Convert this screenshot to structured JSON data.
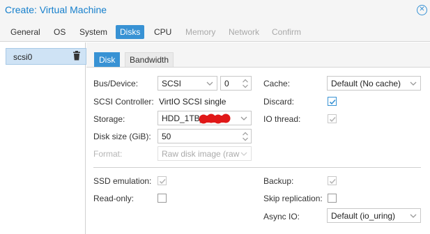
{
  "window": {
    "title": "Create: Virtual Machine"
  },
  "tabs": [
    {
      "label": "General",
      "state": "normal"
    },
    {
      "label": "OS",
      "state": "normal"
    },
    {
      "label": "System",
      "state": "normal"
    },
    {
      "label": "Disks",
      "state": "active"
    },
    {
      "label": "CPU",
      "state": "normal"
    },
    {
      "label": "Memory",
      "state": "disabled"
    },
    {
      "label": "Network",
      "state": "disabled"
    },
    {
      "label": "Confirm",
      "state": "disabled"
    }
  ],
  "disks": [
    {
      "label": "scsi0",
      "icon": "trash-icon"
    }
  ],
  "subtabs": [
    {
      "label": "Disk",
      "active": true
    },
    {
      "label": "Bandwidth",
      "active": false
    }
  ],
  "form": {
    "bus_device": {
      "label": "Bus/Device:",
      "bus": "SCSI",
      "device": "0"
    },
    "scsi_controller": {
      "label": "SCSI Controller:",
      "value": "VirtIO SCSI single"
    },
    "storage": {
      "label": "Storage:",
      "value": "HDD_1TB_"
    },
    "disk_size": {
      "label": "Disk size (GiB):",
      "value": "50"
    },
    "format": {
      "label": "Format:",
      "value": "Raw disk image (raw"
    },
    "cache": {
      "label": "Cache:",
      "value": "Default (No cache)"
    },
    "discard": {
      "label": "Discard:",
      "checked": true
    },
    "io_thread": {
      "label": "IO thread:",
      "checked": true
    },
    "ssd_emulation": {
      "label": "SSD emulation:",
      "checked": true
    },
    "read_only": {
      "label": "Read-only:",
      "checked": false
    },
    "backup": {
      "label": "Backup:",
      "checked": true
    },
    "skip_replication": {
      "label": "Skip replication:",
      "checked": false
    },
    "async_io": {
      "label": "Async IO:",
      "value": "Default (io_uring)"
    }
  },
  "colors": {
    "accent": "#3892d4",
    "title": "#157fcc",
    "selection": "#cfe3f5",
    "redaction": "#e01818"
  }
}
